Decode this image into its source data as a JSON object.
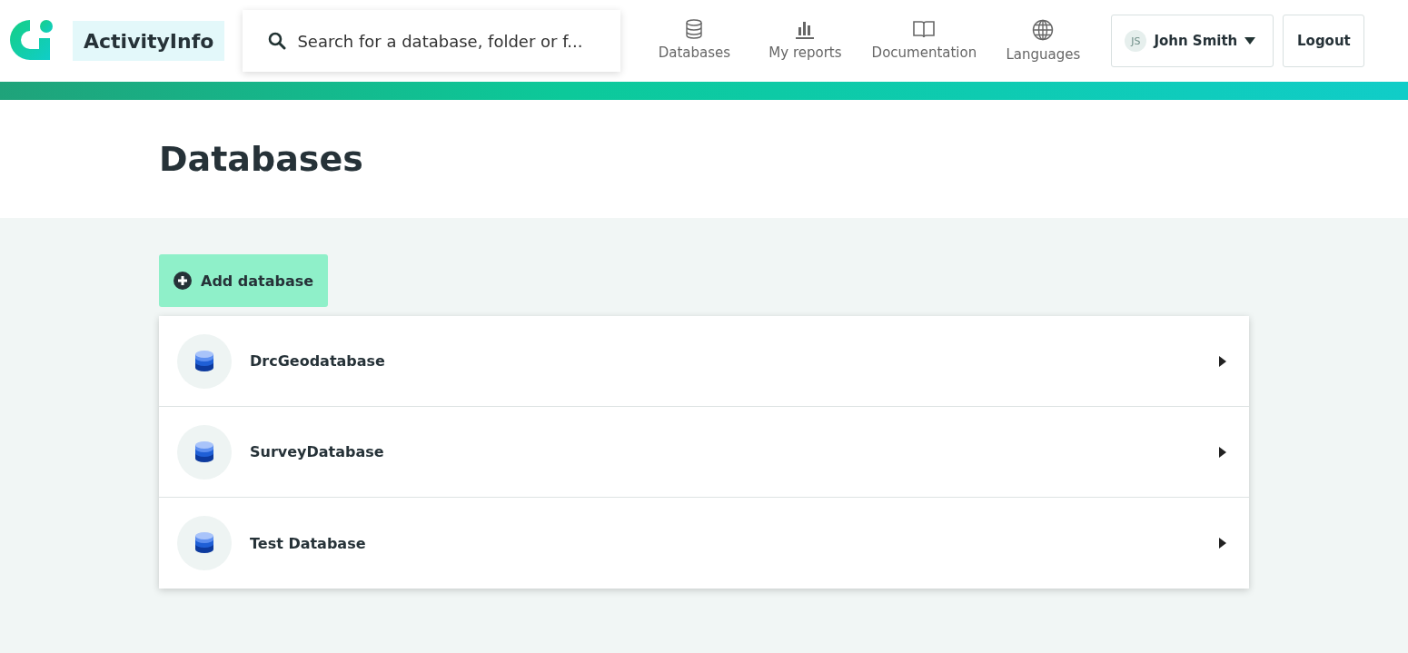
{
  "header": {
    "brand": "ActivityInfo",
    "search": {
      "placeholder": "Search for a database, folder or f..."
    },
    "nav": [
      {
        "kind": "database",
        "label": "Databases"
      },
      {
        "kind": "reports",
        "label": "My reports"
      },
      {
        "kind": "book",
        "label": "Documentation"
      },
      {
        "kind": "globe",
        "label": "Languages"
      }
    ],
    "user": {
      "initials": "JS",
      "name": "John Smith"
    },
    "logout": "Logout"
  },
  "page": {
    "title": "Databases",
    "add_button": "Add database",
    "databases": [
      {
        "name": "DrcGeodatabase"
      },
      {
        "name": "SurveyDatabase"
      },
      {
        "name": "Test Database"
      }
    ]
  }
}
